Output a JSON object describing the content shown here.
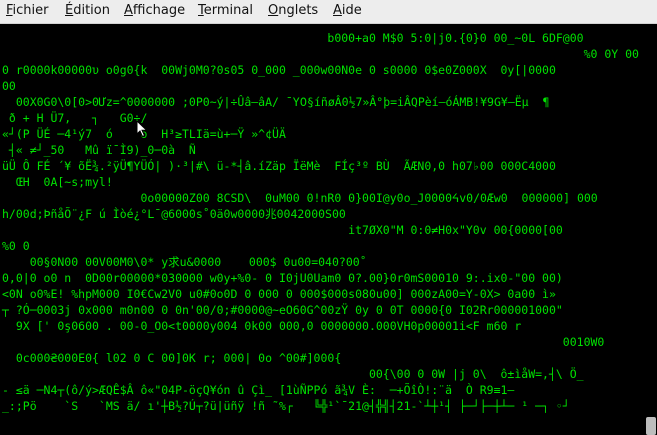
{
  "menu": {
    "items": [
      {
        "label": "Fichier",
        "mnemonic": "F",
        "rest": "ichier"
      },
      {
        "label": "Édition",
        "mnemonic": "É",
        "rest": "dition"
      },
      {
        "label": "Affichage",
        "mnemonic": "A",
        "rest": "ffichage"
      },
      {
        "label": "Terminal",
        "mnemonic": "T",
        "rest": "erminal"
      },
      {
        "label": "Onglets",
        "mnemonic": "O",
        "rest": "nglets"
      },
      {
        "label": "Aide",
        "mnemonic": "A",
        "rest": "ide"
      }
    ]
  },
  "terminal": {
    "text_color": "#00e100",
    "background": "#000000",
    "lines": [
      "                                               b000+a0 M$0 5:0|j0.{0}0 00_~0L 6DF@00",
      "                                                                                    %0 0Y 00",
      "0 r0000k00000υ o0g0{k  00Wj0M0?0s05 0_000 _000w00N0e 0 s0000 0$e0Z000X  0y[|0000",
      "00",
      "  00X0G0\\0[0>0Ưz=^0000000 ;0P0~ý|÷Ûâ—âA/ ¯Y߀§íñøÂ0½7»Â°þ=iÂQPèí—óÁMB!¥9G¥—Ëµ  ¶",
      " ð + H Ü7,   ┐   G0÷/",
      "«┘(P ÜÉ ─4¹ý7  ó    ó  H³≥TLIä=ù+─Ÿ »^¢ÜÄ",
      " ┤« ≠┘_50   Mû ï¯Ì9)_0─0à  Ñ",
      "üÜ Ô FÉ ´¥ õË¾.²ÿÜ¶YÜÓ| )·³|#\\ ü-*┤â.íZäp ÏëMè  FÍç³º BÙ  ÃÆN0,0 h07♭00 000C4000",
      "  ŒH  0A[~s;myl!",
      "                    0o00000Z00 8CSD\\  0uM00 0!nR0 0}00I@y0o_J0000ᔦv0/0Æw0  000000] 000",
      "h/00d;ÞñåÕ¨¿F ú Ìòé¿°L¯@6000s˚0ä0w0000兆0042000S00",
      "                                                  it7ØX0\"M 0:0≠H0x\"Y0v 00{0000[00",
      "%0 0",
      "    00§0N00 00V00M0\\0* y求u&0000    000$ 0u00=040?00˚",
      "0,0|0 o0 n  0D00r00000*030000 w0y+%0- 0 I0jU0Uam0 0?.00}0r0mS00010 9:.ix0-\"00 00)",
      "<0N o0%E! %hpM000 I0€Cw2V0 u0#0o0D 0 000 0 000$000s080u00] 000zA00=Y-0X> 0a00 ì»",
      "┬ ?Ó─0003j 0x000 m0n00 0 0n'00/0;#0000@~eO60G^00zŸ 0y 0 0T 0000{0 I02Rr000001000\"",
      "  9X [' 0ş0600 . 00-0_O0<t0000y004 0k00 000,0 0000000.000VH0p00001i<F m60 r",
      "                                                                                 0010W0",
      "  0c000₴000E0{ l02 0 C 00]0K r; 000| 0o ^00#]000{",
      "                                                     00{\\00 0 0W |j 0\\  ô±ìåW=,┤\\ Ö_",
      "- ≤ä ─N4┬(ô/ý>ÆQÊ$Â ô«\"04P-öçQ¥ón û Çì_ [1ùÑPPó ã¾V È:  ─+ÕîÒ!:¨ä  Ò R9≡1—",
      "_:;Pö    `S   `MS ä/ ı'┼B½?Ú┬?ü|üñÿ !ñ ˜%┌   ╚╬¹`¯21@┤╬╣┤21-`┴┼¹┤ ├─┘├─┼┴─ ¹ ─┐ ◦┘"
    ]
  },
  "scrollbar": {
    "position_fraction": 1.0
  }
}
